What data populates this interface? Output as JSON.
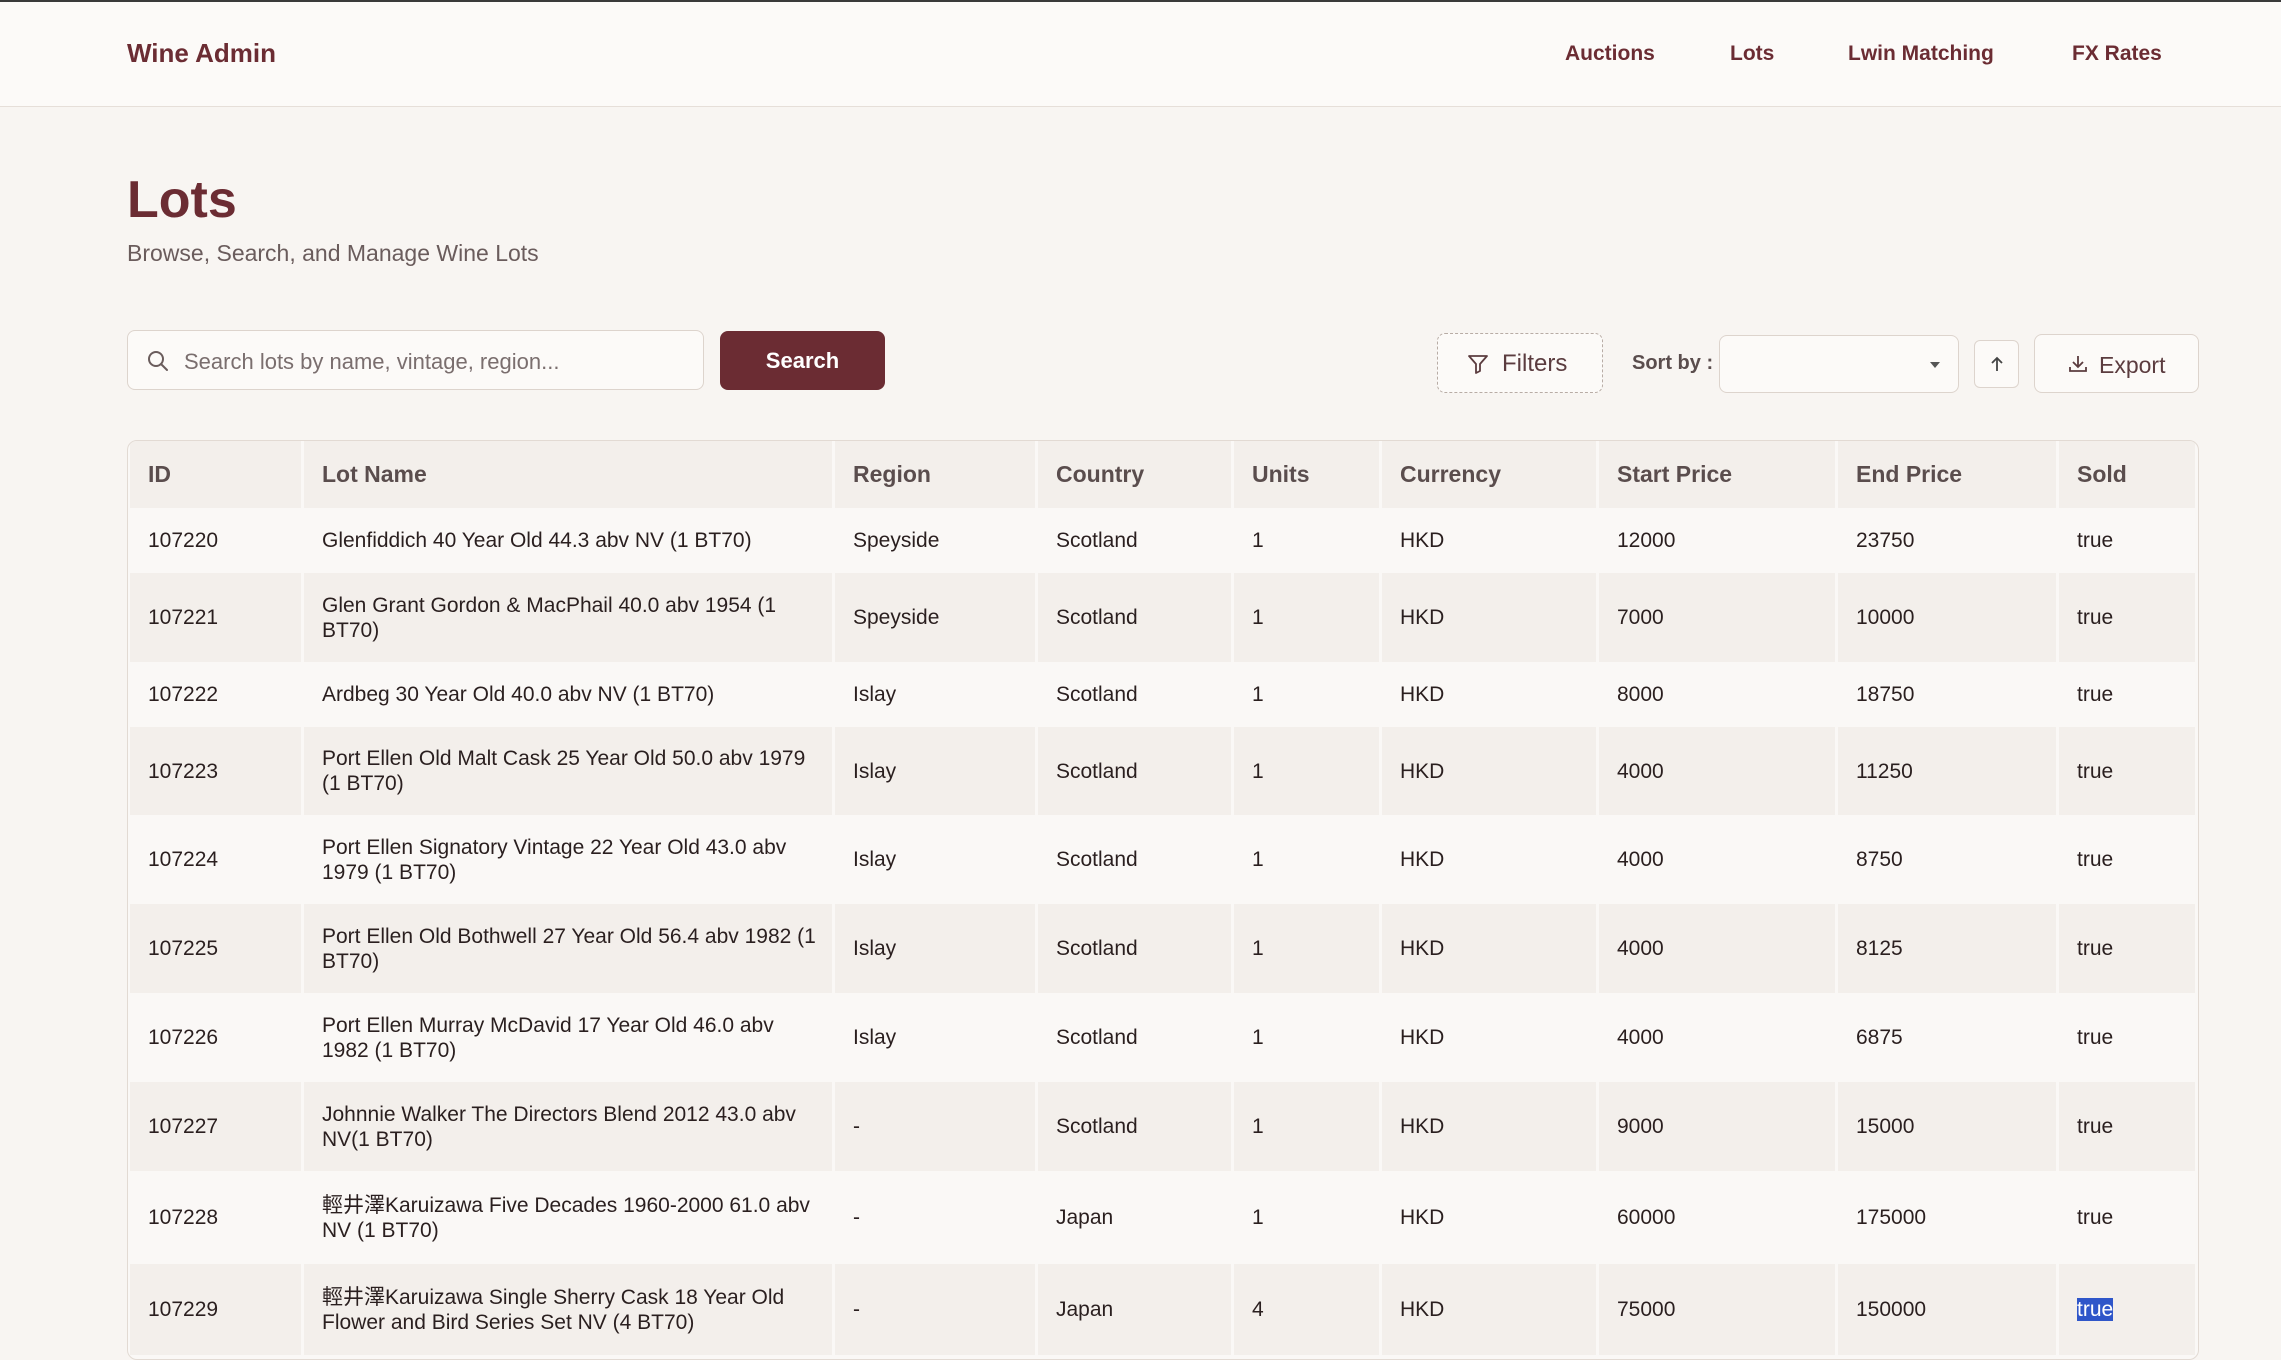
{
  "brand": "Wine Admin",
  "nav": [
    "Auctions",
    "Lots",
    "Lwin Matching",
    "FX Rates"
  ],
  "page": {
    "title": "Lots",
    "subtitle": "Browse, Search, and Manage Wine Lots"
  },
  "toolbar": {
    "search_placeholder": "Search lots by name, vintage, region...",
    "search_value": "",
    "search_label": "Search",
    "filters_label": "Filters",
    "sort_label": "Sort by :",
    "sort_value": "",
    "export_label": "Export"
  },
  "table": {
    "columns": [
      "ID",
      "Lot Name",
      "Region",
      "Country",
      "Units",
      "Currency",
      "Start Price",
      "End Price",
      "Sold"
    ],
    "rows": [
      {
        "id": "107220",
        "name": "Glenfiddich 40 Year Old 44.3 abv NV (1 BT70)",
        "region": "Speyside",
        "country": "Scotland",
        "units": "1",
        "currency": "HKD",
        "start": "12000",
        "end": "23750",
        "sold": "true"
      },
      {
        "id": "107221",
        "name": "Glen Grant Gordon & MacPhail 40.0 abv 1954 (1 BT70)",
        "region": "Speyside",
        "country": "Scotland",
        "units": "1",
        "currency": "HKD",
        "start": "7000",
        "end": "10000",
        "sold": "true"
      },
      {
        "id": "107222",
        "name": "Ardbeg 30 Year Old 40.0 abv NV (1 BT70)",
        "region": "Islay",
        "country": "Scotland",
        "units": "1",
        "currency": "HKD",
        "start": "8000",
        "end": "18750",
        "sold": "true"
      },
      {
        "id": "107223",
        "name": "Port Ellen Old Malt Cask 25 Year Old 50.0 abv 1979 (1 BT70)",
        "region": "Islay",
        "country": "Scotland",
        "units": "1",
        "currency": "HKD",
        "start": "4000",
        "end": "11250",
        "sold": "true"
      },
      {
        "id": "107224",
        "name": "Port Ellen Signatory Vintage 22 Year Old 43.0 abv 1979 (1 BT70)",
        "region": "Islay",
        "country": "Scotland",
        "units": "1",
        "currency": "HKD",
        "start": "4000",
        "end": "8750",
        "sold": "true"
      },
      {
        "id": "107225",
        "name": "Port Ellen Old Bothwell 27 Year Old 56.4 abv 1982 (1 BT70)",
        "region": "Islay",
        "country": "Scotland",
        "units": "1",
        "currency": "HKD",
        "start": "4000",
        "end": "8125",
        "sold": "true"
      },
      {
        "id": "107226",
        "name": "Port Ellen Murray McDavid 17 Year Old 46.0 abv 1982 (1 BT70)",
        "region": "Islay",
        "country": "Scotland",
        "units": "1",
        "currency": "HKD",
        "start": "4000",
        "end": "6875",
        "sold": "true"
      },
      {
        "id": "107227",
        "name": "Johnnie Walker The Directors Blend 2012 43.0 abv NV(1 BT70)",
        "region": "-",
        "country": "Scotland",
        "units": "1",
        "currency": "HKD",
        "start": "9000",
        "end": "15000",
        "sold": "true"
      },
      {
        "id": "107228",
        "name": "輕井澤Karuizawa Five Decades 1960-2000 61.0 abv NV (1 BT70)",
        "region": "-",
        "country": "Japan",
        "units": "1",
        "currency": "HKD",
        "start": "60000",
        "end": "175000",
        "sold": "true"
      },
      {
        "id": "107229",
        "name": "輕井澤Karuizawa Single Sherry Cask 18 Year Old Flower and Bird Series Set NV (4 BT70)",
        "region": "-",
        "country": "Japan",
        "units": "4",
        "currency": "HKD",
        "start": "75000",
        "end": "150000",
        "sold": "true"
      }
    ]
  },
  "colors": {
    "accent": "#6b2c33",
    "background": "#f8f5f2",
    "selection": "#2f56c9"
  }
}
